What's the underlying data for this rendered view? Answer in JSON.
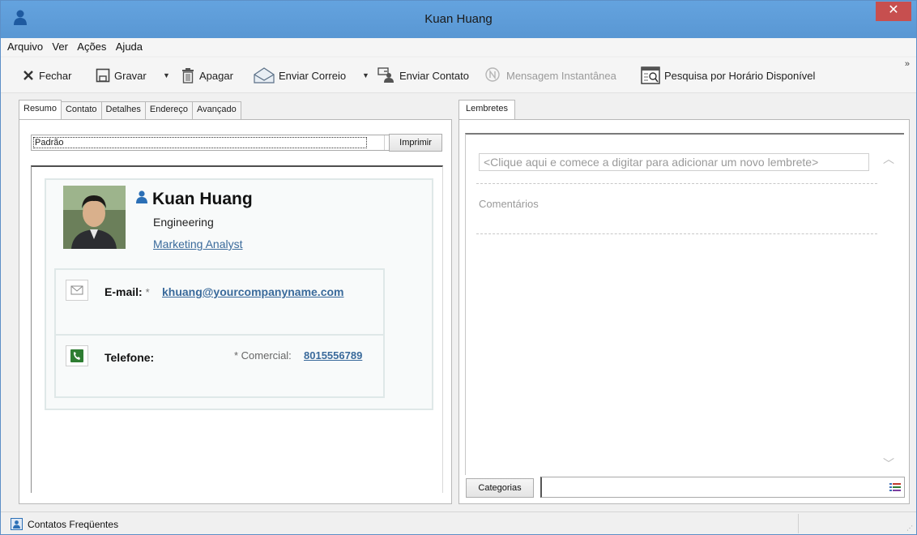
{
  "window": {
    "title": "Kuan Huang",
    "close_glyph": "✕",
    "icon": "contact-person-icon"
  },
  "menu": {
    "items": [
      "Arquivo",
      "Ver",
      "Ações",
      "Ajuda"
    ]
  },
  "toolbar": {
    "close_label": "Fechar",
    "save_label": "Gravar",
    "delete_label": "Apagar",
    "send_mail_label": "Enviar Correio",
    "send_contact_label": "Enviar Contato",
    "instant_message_label": "Mensagem Instantânea",
    "free_busy_label": "Pesquisa por Horário Disponível",
    "overflow_glyph": "»"
  },
  "left_tabs": [
    "Resumo",
    "Contato",
    "Detalhes",
    "Endereço",
    "Avançado"
  ],
  "summary": {
    "view_value": "Padrão",
    "print_label": "Imprimir",
    "name": "Kuan Huang",
    "department": "Engineering",
    "job_title": "Marketing Analyst",
    "email_label": "E-mail:",
    "email_star": "*",
    "email": "khuang@yourcompanyname.com",
    "phone_label": "Telefone:",
    "phone_type": "* Comercial:",
    "phone": "8015556789"
  },
  "right_tabs": [
    "Lembretes"
  ],
  "reminders": {
    "placeholder": "<Clique aqui e comece a digitar para adicionar um novo lembrete>",
    "comments_label": "Comentários",
    "categories_label": "Categorias"
  },
  "statusbar": {
    "text": "Contatos Freqüentes"
  },
  "colors": {
    "titlebar": "#5b9bd5",
    "close": "#c74f4f",
    "link": "#3a6a9b",
    "accent_icon": "#2b6fb6"
  }
}
